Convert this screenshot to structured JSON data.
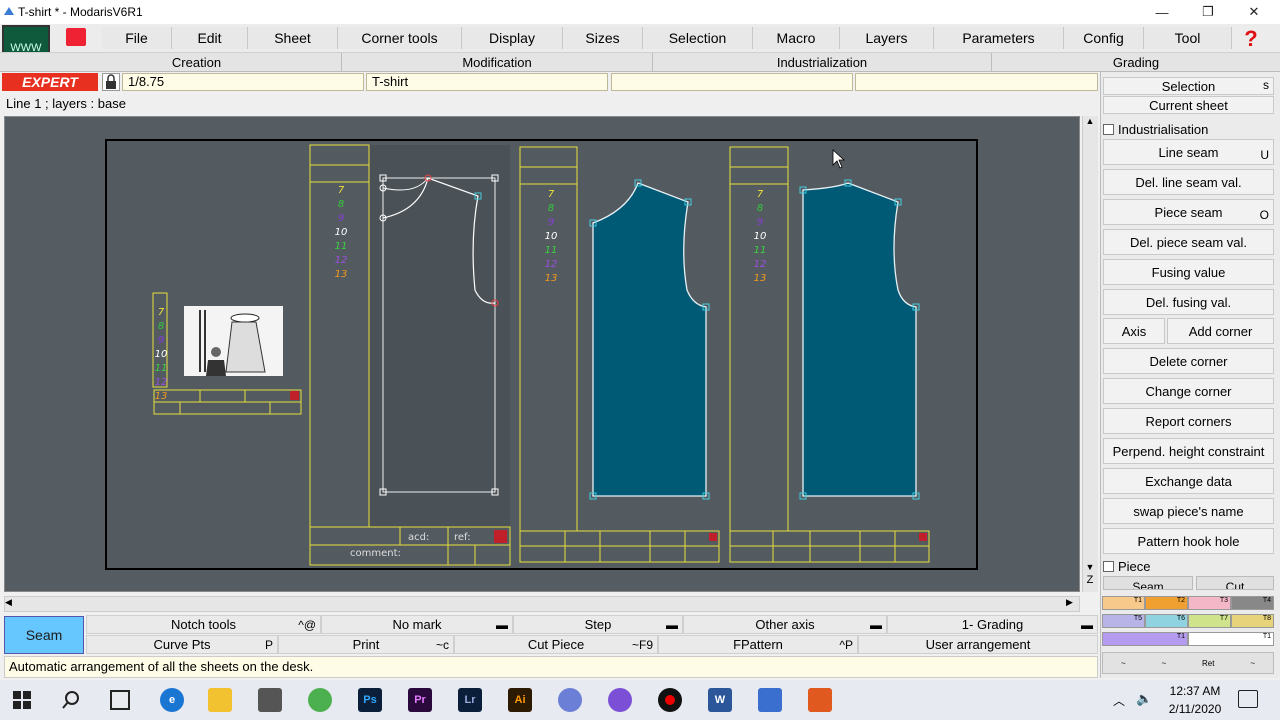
{
  "window": {
    "title": "T-shirt * - ModarisV6R1",
    "minimize": "—",
    "maximize": "❐",
    "close": "✕"
  },
  "menu": {
    "logo": "WWW",
    "items": [
      "File",
      "Edit",
      "Sheet",
      "Corner tools",
      "Display",
      "Sizes",
      "Selection",
      "Macro",
      "Layers",
      "Parameters",
      "Config",
      "Tool"
    ],
    "help": "?"
  },
  "categories": [
    "Creation",
    "Modification",
    "Industrialization",
    "Grading"
  ],
  "fields": {
    "expert": "EXPERT",
    "scale": "1/8.75",
    "model_name": "T-shirt",
    "blank1": "",
    "blank2": ""
  },
  "infoline": "Line 1   ;   layers :  base",
  "sheet": {
    "sizes": [
      "7",
      "8",
      "9",
      "10",
      "11",
      "12",
      "13"
    ],
    "size_colors": [
      "#f3e03a",
      "#34c83a",
      "#8a3bd6",
      "#ffffff",
      "#3cd23c",
      "#9b4de0",
      "#f39a1a"
    ],
    "acd_label": "acd:",
    "ref_label": "ref:",
    "comment_label": "comment:"
  },
  "sidebar": {
    "selection": "Selection",
    "selection_key": "s",
    "current_sheet": "Current sheet",
    "industrialisation": "Industrialisation",
    "buttons": [
      {
        "label": "Line seam",
        "key": "U"
      },
      {
        "label": "Del. line seam val.",
        "key": ""
      },
      {
        "label": "Piece seam",
        "key": "O"
      },
      {
        "label": "Del. piece seam val.",
        "key": ""
      },
      {
        "label": "Fusing value",
        "key": ""
      },
      {
        "label": "Del. fusing val.",
        "key": ""
      }
    ],
    "axis": "Axis",
    "add_corner": "Add corner",
    "buttons2": [
      {
        "label": "Delete corner"
      },
      {
        "label": "Change corner"
      },
      {
        "label": "Report corners"
      },
      {
        "label": "Perpend. height constraint"
      },
      {
        "label": "Exchange data"
      },
      {
        "label": "swap piece's name"
      },
      {
        "label": "Pattern hook hole"
      }
    ],
    "piece": "Piece",
    "seam_tab": "Seam",
    "cut_tab": "Cut",
    "palette_row1": [
      "T1",
      "T2",
      "T3",
      "T4"
    ],
    "palette_row2": [
      "T5",
      "T6",
      "T7",
      "T8"
    ],
    "palette_row3": [
      "T1",
      "T1"
    ],
    "palette_bottom": [
      "~",
      "~",
      "Ret",
      "~"
    ]
  },
  "scrollbar": {
    "z_label": "Z"
  },
  "bottom": {
    "seam": "Seam",
    "row1": [
      {
        "label": "Notch tools",
        "shortcut": "^@"
      },
      {
        "label": "No mark",
        "shortcut": "▬"
      },
      {
        "label": "Step",
        "shortcut": "▬"
      },
      {
        "label": "Other axis",
        "shortcut": "▬"
      },
      {
        "label": "1- Grading",
        "shortcut": "▬"
      }
    ],
    "row2": [
      {
        "label": "Curve Pts",
        "shortcut": "P"
      },
      {
        "label": "Print",
        "shortcut": "~c"
      },
      {
        "label": "Cut Piece",
        "shortcut": "~F9"
      },
      {
        "label": "FPattern",
        "shortcut": "^P"
      },
      {
        "label": "User arrangement",
        "shortcut": ""
      }
    ]
  },
  "status": "Automatic arrangement of all the sheets on the desk.",
  "taskbar": {
    "time": "12:37 AM",
    "date": "2/11/2020",
    "apps": [
      "Ps",
      "Pr",
      "Lr",
      "Ai",
      "W"
    ]
  }
}
